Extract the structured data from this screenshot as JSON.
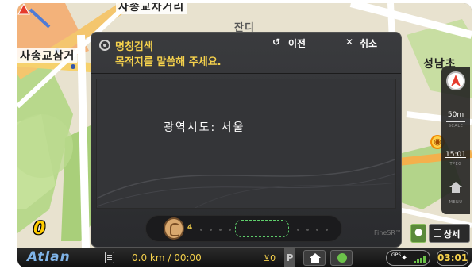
{
  "map": {
    "label_top": "사송교차거리",
    "label_left": "사송교삼거",
    "label_right": "성남초",
    "label_center": "잔디",
    "zoom_level": "0"
  },
  "right_panel": {
    "scale_value": "50m",
    "scale_caption": "SCALE",
    "tpeg_time": "15:01",
    "tpeg_caption": "TPEG",
    "menu_caption": "MENU",
    "compass_icon": "compass-icon",
    "menu_icon": "home-icon"
  },
  "dialog": {
    "title": "명칭검색",
    "subtitle": "목적지를 말씀해 주세요.",
    "prev_label": "이전",
    "cancel_label": "취소",
    "recognized_text": "광역시도: 서울",
    "voice_level": "4",
    "engine_label": "FineSR™"
  },
  "map_buttons": {
    "detail_label": "상세"
  },
  "status_bar": {
    "brand": "Atlan",
    "distance_time": "0.0 km / 00:00",
    "signal_count": "0",
    "p_label": "P",
    "gps_label": "GPS",
    "clock": "03:01"
  },
  "colors": {
    "accent_yellow": "#f5d14c",
    "dialog_bg": "#2a2b2e",
    "map_bg": "#e8e2cf",
    "status_green": "#6cc24a"
  }
}
